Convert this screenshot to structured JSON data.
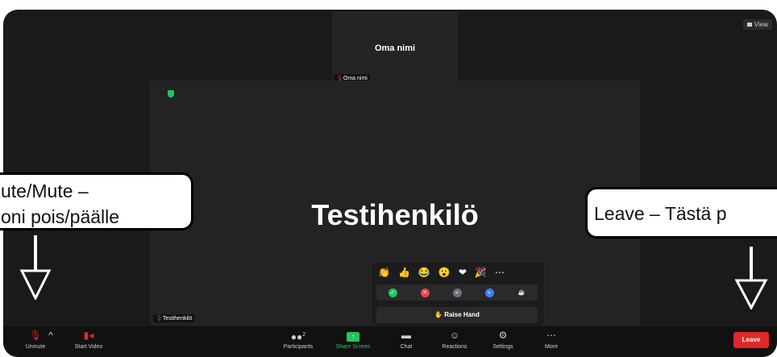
{
  "view_button": {
    "label": "View"
  },
  "participants": {
    "self": {
      "tile_name": "Oma nimi",
      "tag": "Oma nimi"
    },
    "speaker": {
      "tile_name": "Testihenkilö",
      "tag": "Testihenkilö"
    }
  },
  "reactions_panel": {
    "emojis": [
      "👏",
      "👍",
      "😂",
      "😮",
      "❤",
      "🎉",
      "⋯"
    ],
    "status_icons": [
      {
        "icon": "check-icon",
        "color": "#22c55e",
        "glyph": "✓"
      },
      {
        "icon": "x-icon",
        "color": "#ef4444",
        "glyph": "✕"
      },
      {
        "icon": "slow-down-icon",
        "color": "#6b7280",
        "glyph": "«"
      },
      {
        "icon": "speed-up-icon",
        "color": "#3b82f6",
        "glyph": "»"
      },
      {
        "icon": "coffee-icon",
        "color": "#2a2a2a",
        "glyph": "☕"
      }
    ],
    "raise_hand": "Raise Hand"
  },
  "toolbar": {
    "unmute": "Unmute",
    "start_video": "Start Video",
    "participants": "Participants",
    "participants_count": "2",
    "share_screen": "Share Screen",
    "chat": "Chat",
    "reactions": "Reactions",
    "settings": "Settings",
    "more": "More",
    "leave": "Leave",
    "share_color": "#22c55e"
  },
  "callouts": {
    "left": {
      "line1": "ute/Mute  –",
      "line2": "oni pois/päälle"
    },
    "right": {
      "line1": "Leave – Tästä p"
    }
  }
}
